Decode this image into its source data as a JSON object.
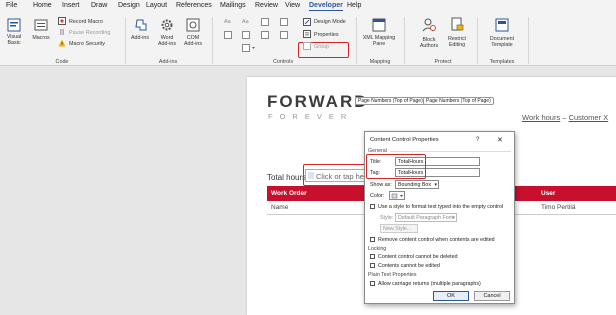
{
  "menu": [
    "File",
    "Home",
    "Insert",
    "Draw",
    "Design",
    "Layout",
    "References",
    "Mailings",
    "Review",
    "View",
    "Developer",
    "Help"
  ],
  "ribbon": {
    "visual_basic": "Visual Basic",
    "macros": "Macros",
    "record_macro": "Record Macro",
    "pause_recording": "Pause Recording",
    "macro_security": "Macro Security",
    "group_code": "Code",
    "addins": "Add-ins",
    "word_addins": "Word Add-ins",
    "com_addins": "COM Add-ins",
    "group_addins": "Add-ins",
    "design_mode": "Design Mode",
    "properties": "Properties",
    "group_btn": "Group",
    "group_controls": "Controls",
    "xml_mapping": "XML Mapping Pane",
    "group_mapping": "Mapping",
    "block_authors": "Block Authors",
    "restrict_editing": "Restrict Editing",
    "group_protect": "Protect",
    "document_template": "Document Template",
    "group_templates": "Templates"
  },
  "doc": {
    "logo": "FORWARD",
    "logo_sub": "FOREVER",
    "page_number_1": "Page Numbers (Top of Page)",
    "page_number_2": "Page Numbers (Top of Page)",
    "header_right_1": "Work hours",
    "header_right_sep": " – ",
    "header_right_2": "Customer X",
    "total_hours_label": "Total hours:",
    "placeholder": "Click or tap here t",
    "table": {
      "col1": "Work Order",
      "col2": "User",
      "row1_col1": "Name",
      "row1_col2": "Timo Pertilä"
    },
    "accent_color": "#c8102e"
  },
  "dialog": {
    "title": "Content Control Properties",
    "help": "?",
    "close": "✕",
    "general": "General",
    "title_label": "Title:",
    "title_value": "TotalHours",
    "tag_label": "Tag:",
    "tag_value": "TotalHours",
    "show_as_label": "Show as:",
    "show_as_value": "Bounding Box",
    "color_label": "Color:",
    "use_style": "Use a style to format text typed into the empty control",
    "style_label": "Style:",
    "style_value": "Default Paragraph Font",
    "new_style": "New Style...",
    "remove_when_edited": "Remove content control when contents are edited",
    "locking": "Locking",
    "cannot_delete": "Content control cannot be deleted",
    "cannot_edit": "Contents cannot be edited",
    "plain_text": "Plain Text Properties",
    "allow_carriage": "Allow carriage returns (multiple paragraphs)",
    "ok": "OK",
    "cancel": "Cancel"
  }
}
